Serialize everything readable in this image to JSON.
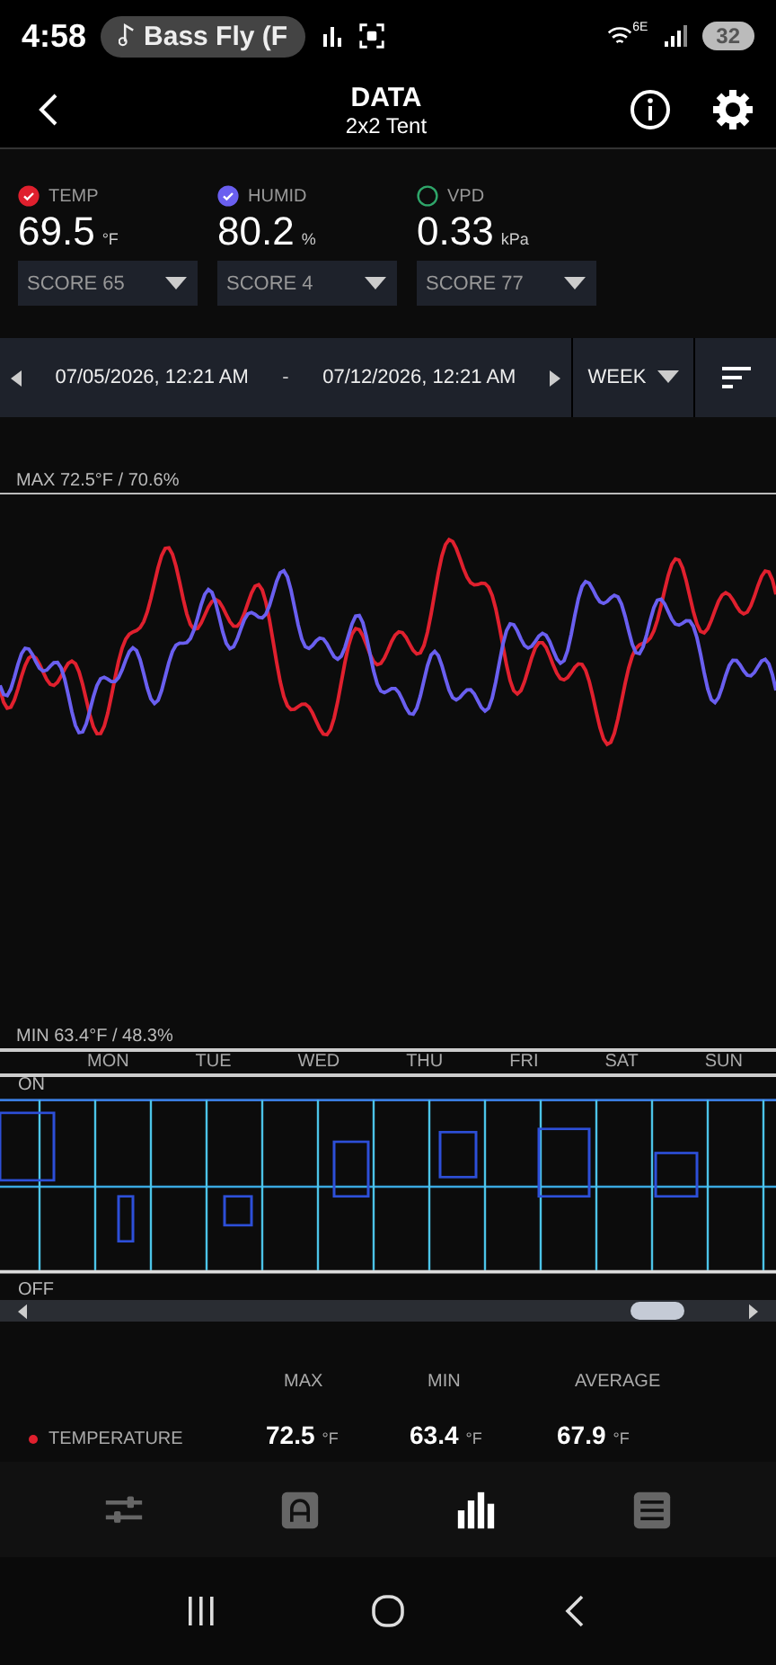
{
  "status_bar": {
    "time": "4:58",
    "media": "Bass Fly (F",
    "wifi_label": "6E",
    "battery": "32"
  },
  "header": {
    "title": "DATA",
    "subtitle": "2x2 Tent"
  },
  "metrics": [
    {
      "label": "TEMP",
      "value": "69.5",
      "unit": "°F",
      "checked": true,
      "color": "#e0202e",
      "score": "SCORE 65"
    },
    {
      "label": "HUMID",
      "value": "80.2",
      "unit": "%",
      "checked": true,
      "color": "#6a5ff0",
      "score": "SCORE 4"
    },
    {
      "label": "VPD",
      "value": "0.33",
      "unit": "kPa",
      "checked": false,
      "color": "#2fa66a",
      "score": "SCORE 77"
    }
  ],
  "range": {
    "start": "07/05/2026, 12:21 AM",
    "separator": "-",
    "end": "07/12/2026, 12:21 AM",
    "period": "WEEK"
  },
  "graph": {
    "max_label": "MAX 72.5°F / 70.6%",
    "min_label": "MIN 63.4°F / 48.3%"
  },
  "days": [
    "MON",
    "TUE",
    "WED",
    "THU",
    "FRI",
    "SAT",
    "SUN"
  ],
  "switch_chart": {
    "on_label": "ON",
    "off_label": "OFF"
  },
  "stats": {
    "columns": [
      "MAX",
      "MIN",
      "AVERAGE"
    ],
    "rows": [
      {
        "name": "TEMPERATURE",
        "color": "#e0202e",
        "values": [
          {
            "value": "72.5",
            "unit": "°F"
          },
          {
            "value": "63.4",
            "unit": "°F"
          },
          {
            "value": "67.9",
            "unit": "°F"
          }
        ]
      }
    ]
  },
  "bottom_nav": [
    {
      "kind": "sliders",
      "selected": false
    },
    {
      "kind": "auto",
      "selected": false
    },
    {
      "kind": "chart",
      "selected": true
    },
    {
      "kind": "list",
      "selected": false
    }
  ]
}
